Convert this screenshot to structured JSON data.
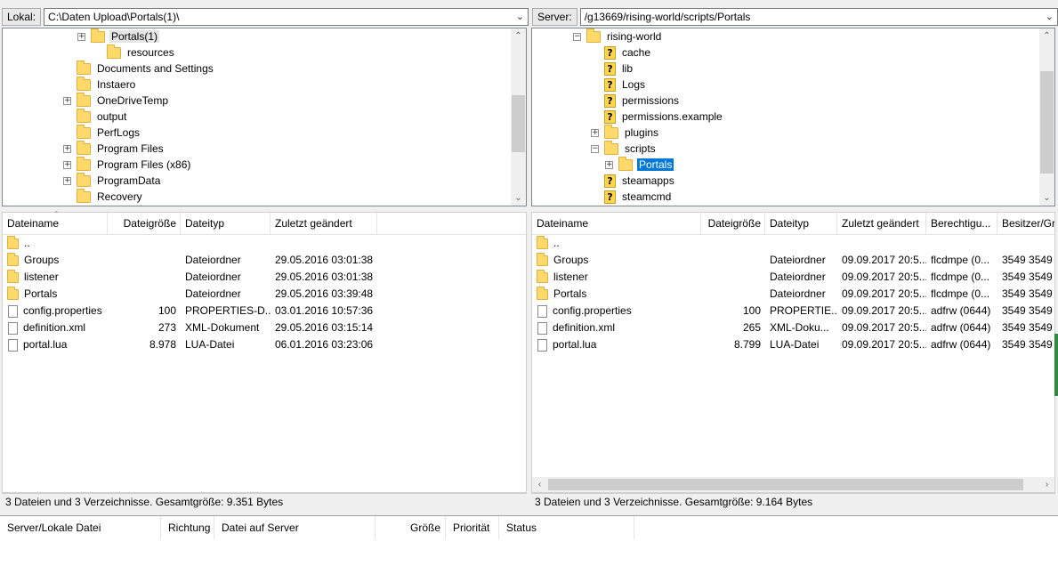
{
  "local": {
    "label": "Lokal:",
    "path": "C:\\Daten Upload\\Portals(1)\\",
    "tree": [
      {
        "name": "Portals(1)",
        "expander": "+",
        "icon": "folder",
        "state": "hover"
      },
      {
        "name": "resources",
        "expander": "",
        "icon": "folder"
      },
      {
        "name": "Documents and Settings",
        "expander": "",
        "icon": "folder"
      },
      {
        "name": "Instaero",
        "expander": "",
        "icon": "folder"
      },
      {
        "name": "OneDriveTemp",
        "expander": "+",
        "icon": "folder"
      },
      {
        "name": "output",
        "expander": "",
        "icon": "folder"
      },
      {
        "name": "PerfLogs",
        "expander": "",
        "icon": "folder"
      },
      {
        "name": "Program Files",
        "expander": "+",
        "icon": "folder"
      },
      {
        "name": "Program Files (x86)",
        "expander": "+",
        "icon": "folder"
      },
      {
        "name": "ProgramData",
        "expander": "+",
        "icon": "folder"
      },
      {
        "name": "Recovery",
        "expander": "",
        "icon": "folder"
      }
    ],
    "columns": [
      "Dateiname",
      "Dateigröße",
      "Dateityp",
      "Zuletzt geändert"
    ],
    "files": [
      {
        "name": "..",
        "size": "",
        "type": "",
        "modified": "",
        "icon": "folder"
      },
      {
        "name": "Groups",
        "size": "",
        "type": "Dateiordner",
        "modified": "29.05.2016 03:01:38",
        "icon": "folder"
      },
      {
        "name": "listener",
        "size": "",
        "type": "Dateiordner",
        "modified": "29.05.2016 03:01:38",
        "icon": "folder"
      },
      {
        "name": "Portals",
        "size": "",
        "type": "Dateiordner",
        "modified": "29.05.2016 03:39:48",
        "icon": "folder"
      },
      {
        "name": "config.properties",
        "size": "100",
        "type": "PROPERTIES-D...",
        "modified": "03.01.2016 10:57:36",
        "icon": "file"
      },
      {
        "name": "definition.xml",
        "size": "273",
        "type": "XML-Dokument",
        "modified": "29.05.2016 03:15:14",
        "icon": "file"
      },
      {
        "name": "portal.lua",
        "size": "8.978",
        "type": "LUA-Datei",
        "modified": "06.01.2016 03:23:06",
        "icon": "file"
      }
    ],
    "status": "3 Dateien und 3 Verzeichnisse. Gesamtgröße: 9.351 Bytes"
  },
  "remote": {
    "label": "Server:",
    "path": "/g13669/rising-world/scripts/Portals",
    "tree": [
      {
        "name": "rising-world",
        "expander": "−",
        "icon": "folder"
      },
      {
        "name": "cache",
        "expander": "",
        "icon": "unknown"
      },
      {
        "name": "lib",
        "expander": "",
        "icon": "unknown"
      },
      {
        "name": "Logs",
        "expander": "",
        "icon": "unknown"
      },
      {
        "name": "permissions",
        "expander": "",
        "icon": "unknown"
      },
      {
        "name": "permissions.example",
        "expander": "",
        "icon": "unknown"
      },
      {
        "name": "plugins",
        "expander": "+",
        "icon": "folder"
      },
      {
        "name": "scripts",
        "expander": "−",
        "icon": "folder"
      },
      {
        "name": "Portals",
        "expander": "+",
        "icon": "folder",
        "state": "selected"
      },
      {
        "name": "steamapps",
        "expander": "",
        "icon": "unknown"
      },
      {
        "name": "steamcmd",
        "expander": "",
        "icon": "unknown"
      }
    ],
    "columns": [
      "Dateiname",
      "Dateigröße",
      "Dateityp",
      "Zuletzt geändert",
      "Berechtigu...",
      "Besitzer/Gr..."
    ],
    "files": [
      {
        "name": "..",
        "size": "",
        "type": "",
        "modified": "",
        "perm": "",
        "owner": "",
        "icon": "folder"
      },
      {
        "name": "Groups",
        "size": "",
        "type": "Dateiordner",
        "modified": "09.09.2017 20:5...",
        "perm": "flcdmpe (0...",
        "owner": "3549 3549",
        "icon": "folder"
      },
      {
        "name": "listener",
        "size": "",
        "type": "Dateiordner",
        "modified": "09.09.2017 20:5...",
        "perm": "flcdmpe (0...",
        "owner": "3549 3549",
        "icon": "folder"
      },
      {
        "name": "Portals",
        "size": "",
        "type": "Dateiordner",
        "modified": "09.09.2017 20:5...",
        "perm": "flcdmpe (0...",
        "owner": "3549 3549",
        "icon": "folder"
      },
      {
        "name": "config.properties",
        "size": "100",
        "type": "PROPERTIE...",
        "modified": "09.09.2017 20:5...",
        "perm": "adfrw (0644)",
        "owner": "3549 3549",
        "icon": "file"
      },
      {
        "name": "definition.xml",
        "size": "265",
        "type": "XML-Doku...",
        "modified": "09.09.2017 20:5...",
        "perm": "adfrw (0644)",
        "owner": "3549 3549",
        "icon": "file"
      },
      {
        "name": "portal.lua",
        "size": "8.799",
        "type": "LUA-Datei",
        "modified": "09.09.2017 20:5...",
        "perm": "adfrw (0644)",
        "owner": "3549 3549",
        "icon": "file"
      }
    ],
    "status": "3 Dateien und 3 Verzeichnisse. Gesamtgröße: 9.164 Bytes"
  },
  "queue": {
    "columns": [
      "Server/Lokale Datei",
      "Richtung",
      "Datei auf Server",
      "Größe",
      "Priorität",
      "Status"
    ]
  },
  "colors": {
    "selection": "#0078d7",
    "folder": "#ffd969",
    "unknown": "#ffd54a"
  }
}
